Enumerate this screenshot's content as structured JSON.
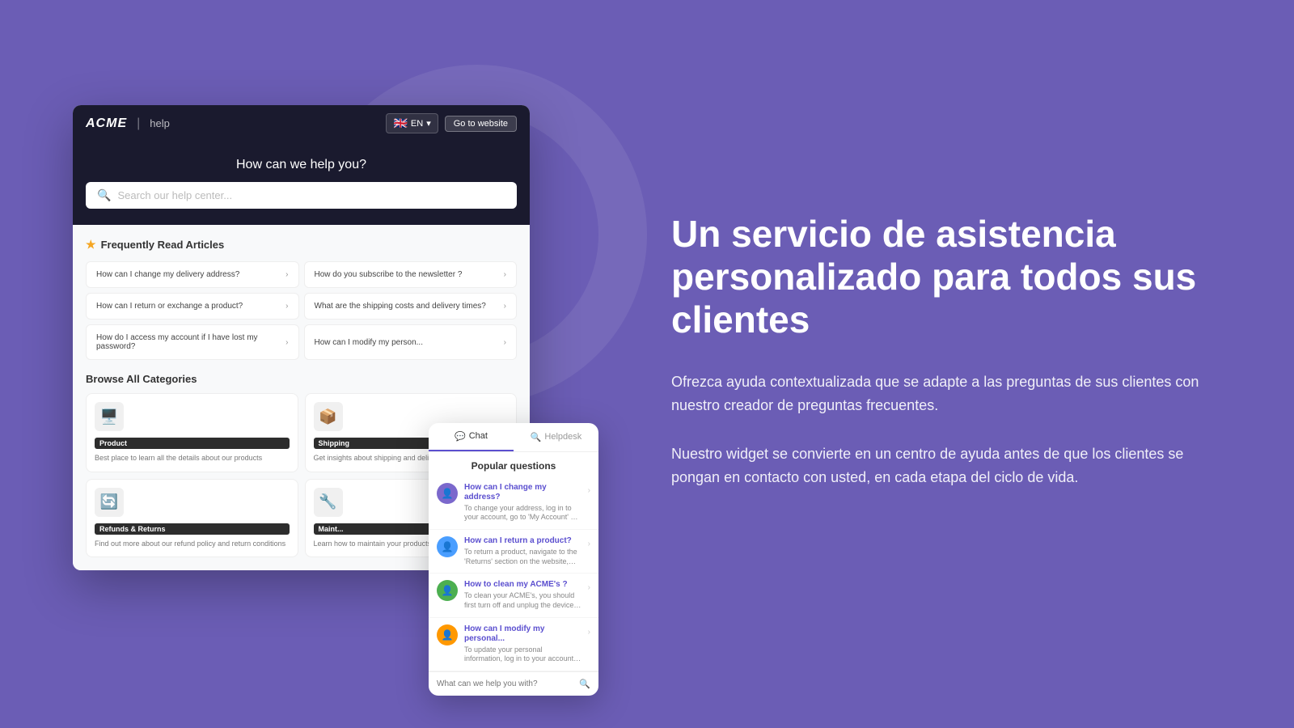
{
  "background_color": "#6b5db5",
  "header": {
    "logo": "ACME",
    "divider": "|",
    "help_label": "help",
    "lang": "EN",
    "go_website_label": "Go to website"
  },
  "hero": {
    "title": "How can we help you?",
    "search_placeholder": "Search our help center..."
  },
  "faq_section": {
    "title": "Frequently Read Articles",
    "items": [
      {
        "text": "How can I change my delivery address?"
      },
      {
        "text": "How do you subscribe to the newsletter ?"
      },
      {
        "text": "How can I return or exchange a product?"
      },
      {
        "text": "What are the shipping costs and delivery times?"
      },
      {
        "text": "How do I access my account if I have lost my password?"
      },
      {
        "text": "How can I modify my person..."
      }
    ]
  },
  "categories_section": {
    "title": "Browse All Categories",
    "items": [
      {
        "badge": "Product",
        "icon": "🖥️",
        "desc": "Best place to learn all the details about our products"
      },
      {
        "badge": "Shipping",
        "icon": "📦",
        "desc": "Get insights about shipping and deliv..."
      },
      {
        "badge": "Refunds & Returns",
        "icon": "🔄",
        "desc": "Find out more about our refund policy and return conditions"
      },
      {
        "badge": "Maint...",
        "icon": "🔧",
        "desc": "Learn how to maintain your products..."
      }
    ]
  },
  "chat_widget": {
    "tabs": [
      {
        "label": "Chat",
        "icon": "💬",
        "active": true
      },
      {
        "label": "Helpdesk",
        "icon": "🔍",
        "active": false
      }
    ],
    "popular_header": "Popular questions",
    "items": [
      {
        "title": "How can I change my address?",
        "desc": "To change your address, log in to your account, go to 'My Account' or 'Settings', locate the 'Address' section and edit the...",
        "avatar_color": "purple",
        "avatar_icon": "👤"
      },
      {
        "title": "How can I return a product?",
        "desc": "To return a product, navigate to the 'Returns' section on the website, initiate a return request by providing the details of...",
        "avatar_color": "blue",
        "avatar_icon": "👤"
      },
      {
        "title": "How to clean my ACME's ?",
        "desc": "To clean your ACME's, you should first turn off and unplug the device, use a soft cloth or brush to remove dust and debris, and...",
        "avatar_color": "green",
        "avatar_icon": "👤"
      },
      {
        "title": "How can I modify my personal...",
        "desc": "To update your personal information, log in to your account, navigate to the 'My...",
        "avatar_color": "orange",
        "avatar_icon": "👤"
      }
    ],
    "input_placeholder": "What can we help you with?"
  },
  "right_panel": {
    "heading": "Un servicio de asistencia personalizado para todos sus clientes",
    "paragraph1": "Ofrezca ayuda contextualizada que se adapte a las preguntas de sus clientes con nuestro creador de preguntas frecuentes.",
    "paragraph2": "Nuestro widget se convierte en un centro de ayuda antes de que los clientes se pongan en contacto con usted, en cada etapa del ciclo de vida."
  }
}
